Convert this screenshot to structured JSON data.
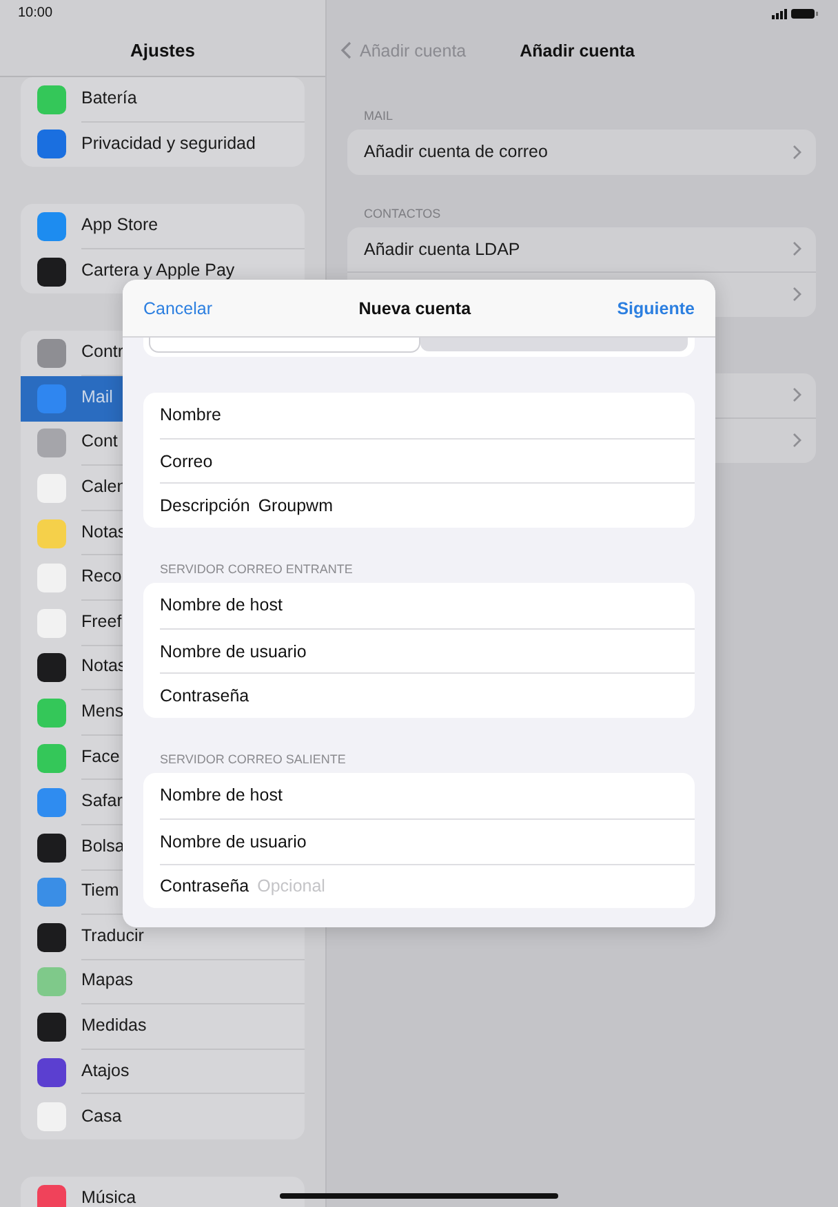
{
  "status_bar": {
    "time": "10:00"
  },
  "sidebar": {
    "title": "Ajustes",
    "groups": [
      {
        "items": [
          {
            "label": "Batería",
            "color": "#34c759",
            "selected": false
          },
          {
            "label": "Privacidad y seguridad",
            "color": "#1a6fe0",
            "selected": false
          }
        ]
      },
      {
        "items": [
          {
            "label": "App Store",
            "color": "#1d8cf0",
            "selected": false
          },
          {
            "label": "Cartera y Apple Pay",
            "color": "#1c1c1e",
            "selected": false
          }
        ]
      },
      {
        "items": [
          {
            "label": "Contr",
            "color": "#8e8e93",
            "selected": false
          },
          {
            "label": "Mail",
            "color": "#2f86f0",
            "selected": true
          },
          {
            "label": "Cont",
            "color": "#a5a5aa",
            "selected": false
          },
          {
            "label": "Calen",
            "color": "#f2f2f2",
            "selected": false
          },
          {
            "label": "Notas",
            "color": "#f5d04a",
            "selected": false
          },
          {
            "label": "Reco",
            "color": "#f2f2f2",
            "selected": false
          },
          {
            "label": "Freef",
            "color": "#f2f2f2",
            "selected": false
          },
          {
            "label": "Notas",
            "color": "#1c1c1e",
            "selected": false
          },
          {
            "label": "Mens",
            "color": "#34c759",
            "selected": false
          },
          {
            "label": "Face",
            "color": "#34c759",
            "selected": false
          },
          {
            "label": "Safar",
            "color": "#2f8cf0",
            "selected": false
          },
          {
            "label": "Bolsa",
            "color": "#1c1c1e",
            "selected": false
          },
          {
            "label": "Tiem",
            "color": "#3a8ee6",
            "selected": false
          },
          {
            "label": "Traducir",
            "color": "#1c1c1e",
            "selected": false
          },
          {
            "label": "Mapas",
            "color": "#7fc98a",
            "selected": false
          },
          {
            "label": "Medidas",
            "color": "#1c1c1e",
            "selected": false
          },
          {
            "label": "Atajos",
            "color": "#5b3fd0",
            "selected": false
          },
          {
            "label": "Casa",
            "color": "#f2f2f2",
            "selected": false
          }
        ]
      },
      {
        "items": [
          {
            "label": "Música",
            "color": "#f0425a",
            "selected": false
          }
        ]
      }
    ]
  },
  "detail": {
    "back": "Añadir cuenta",
    "title": "Añadir cuenta",
    "sections": [
      {
        "header": "MAIL",
        "rows": [
          "Añadir cuenta de correo"
        ]
      },
      {
        "header": "CONTACTOS",
        "rows": [
          "Añadir cuenta LDAP"
        ]
      }
    ]
  },
  "dialog": {
    "cancel": "Cancelar",
    "title": "Nueva cuenta",
    "next": "Siguiente",
    "segments": [
      {
        "selected": true
      },
      {
        "selected": false
      }
    ],
    "groups": [
      {
        "rows": [
          {
            "label": "Nombre"
          },
          {
            "label": "Correo"
          },
          {
            "label": "Descripción",
            "value": "Groupwm"
          }
        ]
      },
      {
        "header": "SERVIDOR CORREO ENTRANTE",
        "rows": [
          {
            "label": "Nombre de host"
          },
          {
            "label": "Nombre de usuario"
          },
          {
            "label": "Contraseña"
          }
        ]
      },
      {
        "header": "SERVIDOR CORREO SALIENTE",
        "rows": [
          {
            "label": "Nombre de host"
          },
          {
            "label": "Nombre de usuario"
          },
          {
            "label": "Contraseña",
            "placeholder": "Opcional"
          }
        ]
      }
    ]
  }
}
